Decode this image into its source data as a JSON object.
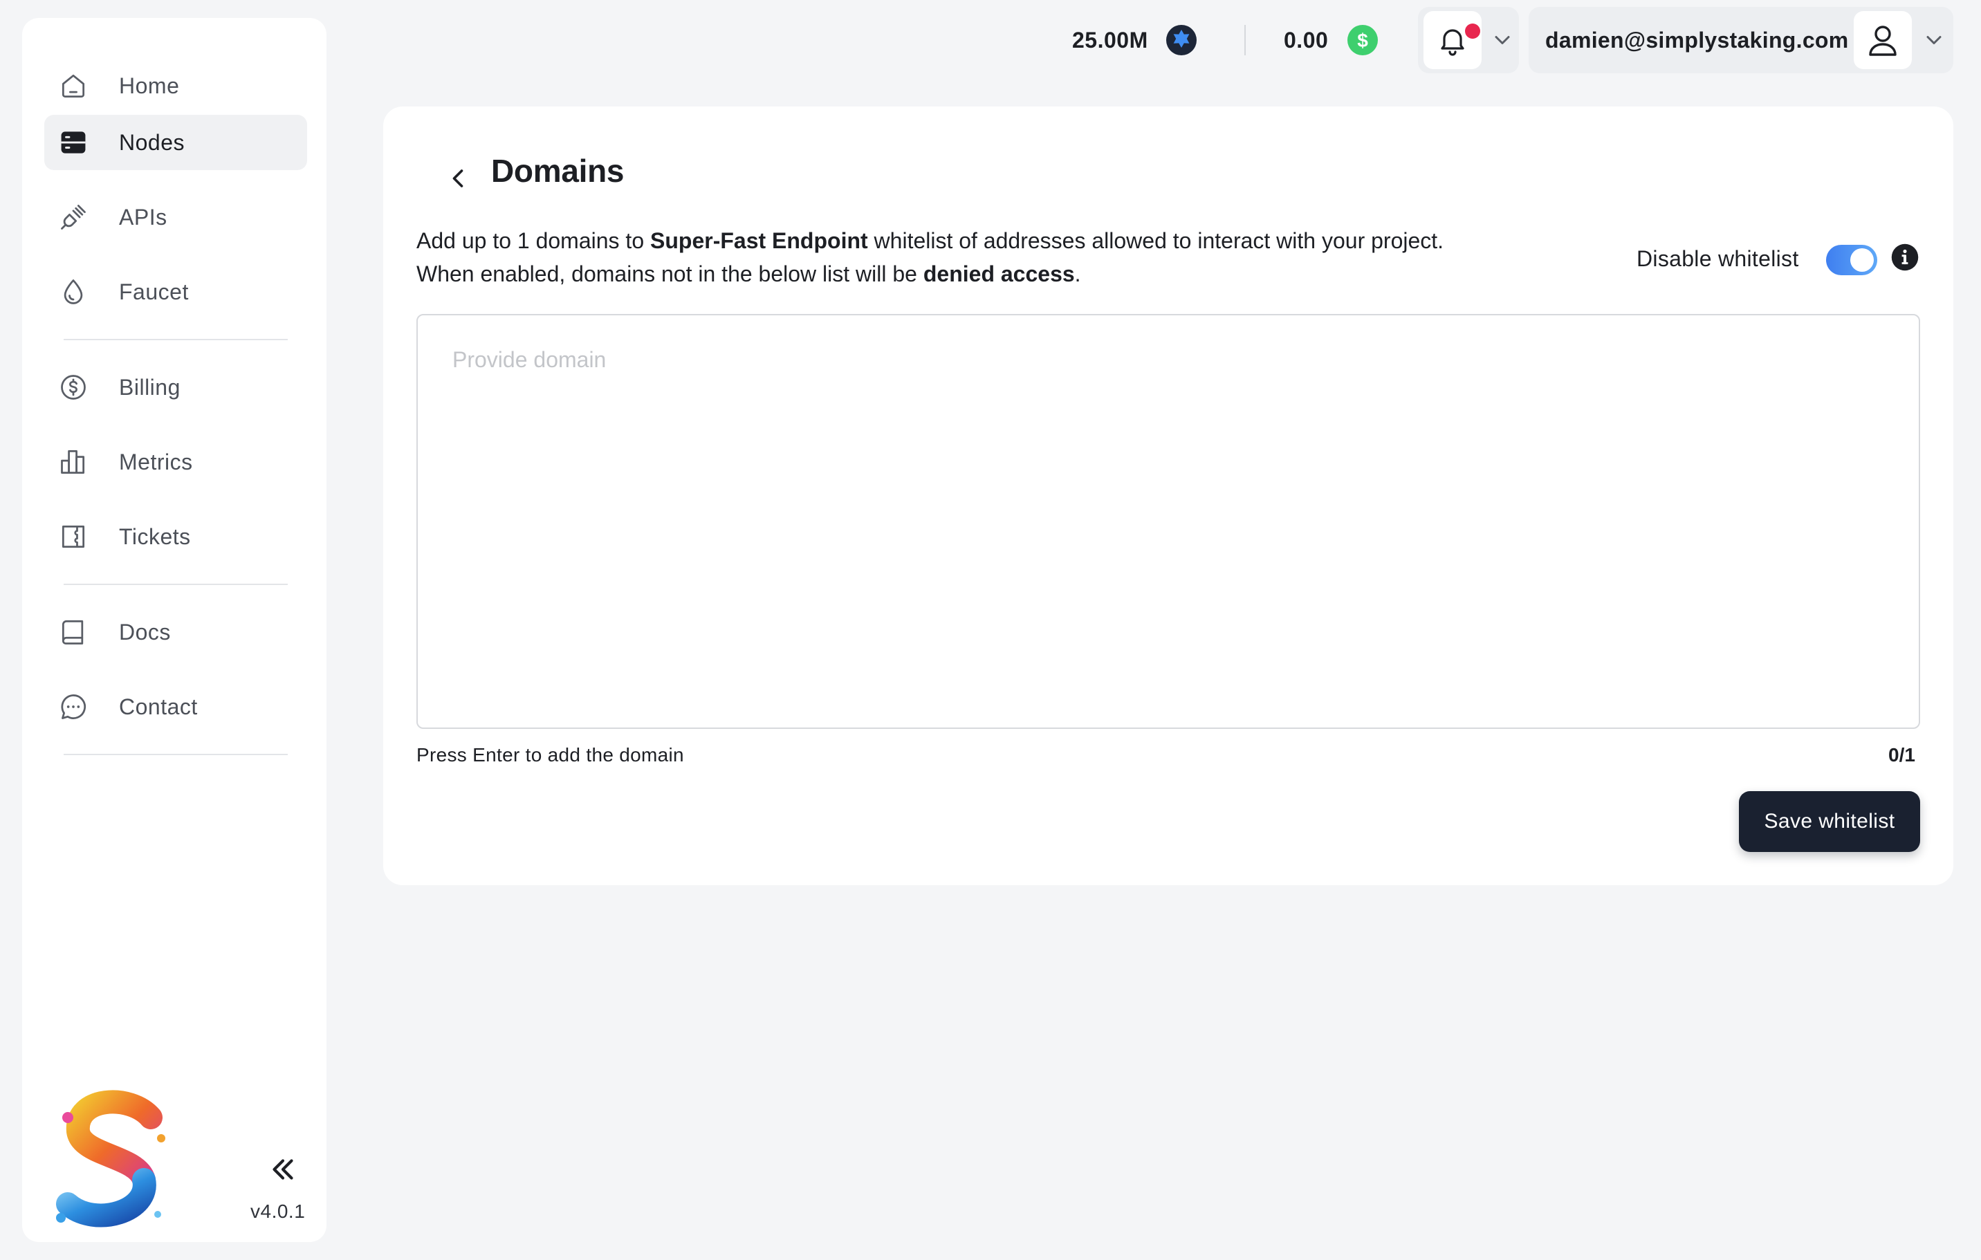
{
  "sidebar": {
    "items": [
      {
        "label": "Home",
        "icon": "home-icon"
      },
      {
        "label": "Nodes",
        "icon": "server-icon",
        "active": true
      },
      {
        "label": "APIs",
        "icon": "plug-icon"
      },
      {
        "label": "Faucet",
        "icon": "droplet-icon"
      },
      {
        "label": "Billing",
        "icon": "dollar-circle-icon"
      },
      {
        "label": "Metrics",
        "icon": "bar-chart-icon"
      },
      {
        "label": "Tickets",
        "icon": "ticket-icon"
      },
      {
        "label": "Docs",
        "icon": "book-icon"
      },
      {
        "label": "Contact",
        "icon": "chat-bubble-icon"
      }
    ],
    "version": "v4.0.1",
    "collapse_icon": "double-chevron-left-icon"
  },
  "topbar": {
    "credits": {
      "value": "25.00M",
      "icon": "star-badge-icon",
      "color": "#2f6fd6"
    },
    "balance": {
      "value": "0.00",
      "icon": "dollar-coin-icon",
      "color": "#3ecf6e"
    },
    "notifications": {
      "icon": "bell-icon",
      "has_unread": true,
      "dot_color": "#e8264e"
    },
    "user": {
      "email": "damien@simplystaking.com",
      "icon": "user-icon"
    }
  },
  "page": {
    "title": "Domains",
    "description": {
      "line1_prefix": "Add up to 1 domains to ",
      "endpoint_name": "Super-Fast Endpoint",
      "line1_suffix": " whitelist of addresses allowed to interact with your project.",
      "line2_prefix": "When enabled, domains not in the below list will be ",
      "line2_emphasis": "denied access",
      "line2_suffix": "."
    },
    "toggle": {
      "label": "Disable whitelist",
      "enabled": true,
      "accent": "#3f7ff0"
    },
    "domain_input": {
      "placeholder": "Provide domain",
      "value": ""
    },
    "hint": "Press Enter to add the domain",
    "counter": "0/1",
    "save_label": "Save whitelist"
  }
}
